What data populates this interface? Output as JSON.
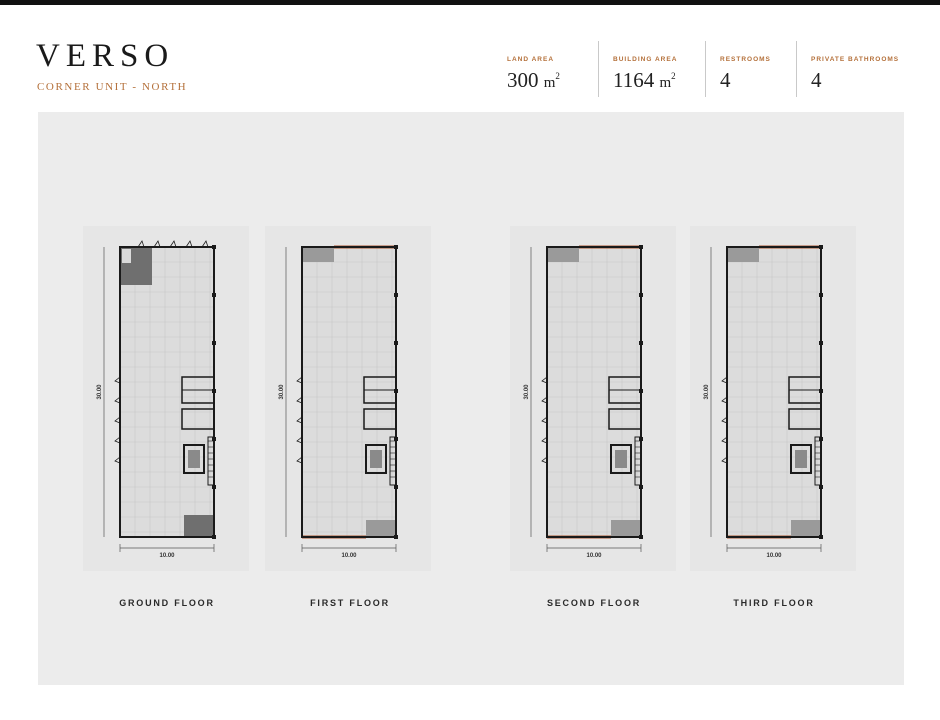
{
  "header": {
    "title": "VERSO",
    "subtitle": "CORNER UNIT - NORTH"
  },
  "stats": [
    {
      "label": "LAND AREA",
      "value": "300",
      "unit": "m",
      "sup": "2"
    },
    {
      "label": "BUILDING AREA",
      "value": "1164",
      "unit": "m",
      "sup": "2"
    },
    {
      "label": "RESTROOMS",
      "value": "4"
    },
    {
      "label": "PRIVATE BATHROOMS",
      "value": "4"
    }
  ],
  "plans": [
    {
      "label": "GROUND FLOOR",
      "width_dim": "10.00",
      "depth_dim": "30.00"
    },
    {
      "label": "FIRST FLOOR",
      "width_dim": "10.00",
      "depth_dim": "30.00"
    },
    {
      "label": "SECOND FLOOR",
      "width_dim": "10.00",
      "depth_dim": "30.00"
    },
    {
      "label": "THIRD FLOOR",
      "width_dim": "10.00",
      "depth_dim": "30.00"
    }
  ],
  "colors": {
    "accent": "#b4703a",
    "facade": "#a8532d",
    "wall": "#1a1a1a",
    "floor": "#dcdcdc"
  }
}
